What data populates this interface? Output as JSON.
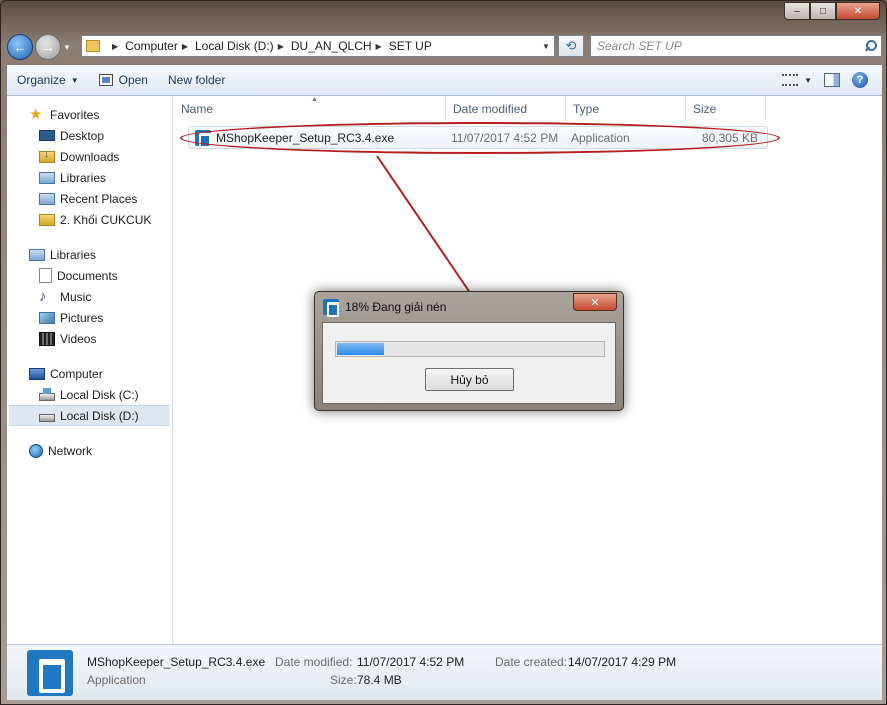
{
  "window": {
    "caption_buttons": {
      "minimize": "–",
      "maximize": "□",
      "close": "✕"
    }
  },
  "navbar": {
    "breadcrumbs": [
      "Computer",
      "Local Disk (D:)",
      "DU_AN_QLCH",
      "SET UP"
    ],
    "search_placeholder": "Search SET UP"
  },
  "commandbar": {
    "organize": "Organize",
    "open": "Open",
    "new_folder": "New folder"
  },
  "navpane": {
    "favorites_header": "Favorites",
    "favorites": [
      "Desktop",
      "Downloads",
      "Libraries",
      "Recent Places",
      "2. Khối CUKCUK"
    ],
    "libraries_header": "Libraries",
    "libraries": [
      "Documents",
      "Music",
      "Pictures",
      "Videos"
    ],
    "computer_header": "Computer",
    "drives": [
      "Local Disk (C:)",
      "Local Disk (D:)"
    ],
    "network_header": "Network"
  },
  "columns": {
    "name": "Name",
    "date": "Date modified",
    "type": "Type",
    "size": "Size"
  },
  "file": {
    "name": "MShopKeeper_Setup_RC3.4.exe",
    "date": "11/07/2017 4:52 PM",
    "type": "Application",
    "size": "80,305 KB"
  },
  "details": {
    "name": "MShopKeeper_Setup_RC3.4.exe",
    "type": "Application",
    "modified_label": "Date modified:",
    "modified_value": "11/07/2017 4:52 PM",
    "created_label": "Date created:",
    "created_value": "14/07/2017 4:29 PM",
    "size_label": "Size:",
    "size_value": "78.4 MB"
  },
  "dialog": {
    "title": "18% Đang giải nén",
    "progress_percent": 18,
    "cancel_label": "Hủy bỏ"
  },
  "colors": {
    "annotation_red": "#b51e1e",
    "progress_blue": "#2b8ae8",
    "app_icon_blue": "#1d72b8"
  }
}
